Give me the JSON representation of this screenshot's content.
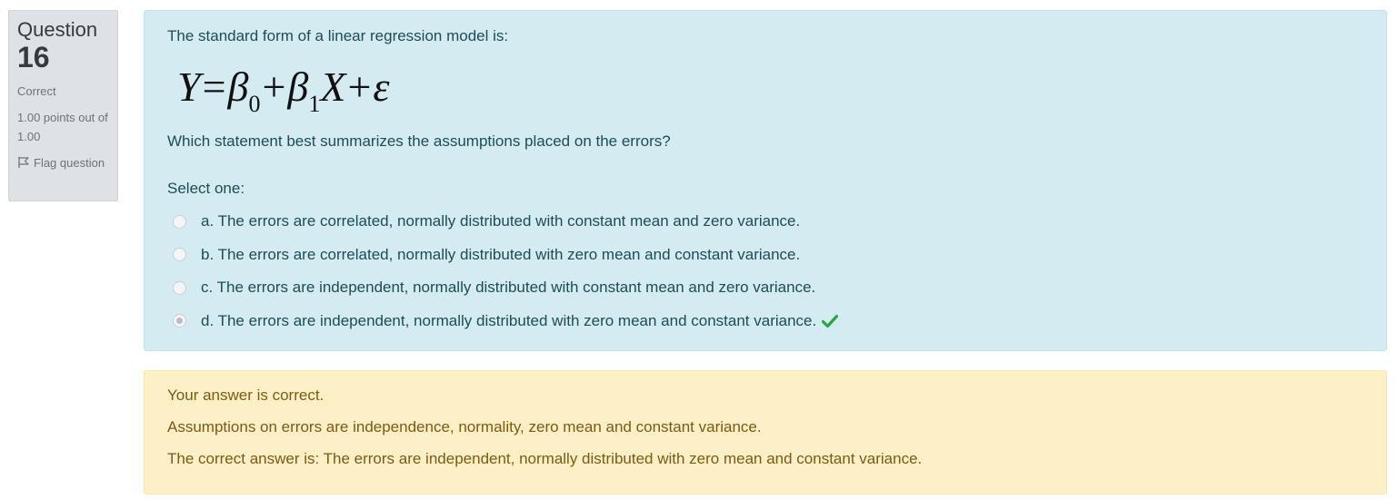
{
  "info": {
    "question_label": "Question",
    "question_number": "16",
    "state": "Correct",
    "grade": "1.00 points out of 1.00",
    "flag_label": "Flag question"
  },
  "question": {
    "intro": "The standard form of a linear regression model is:",
    "formula": {
      "y": "Y",
      "eq": "=",
      "beta": "β",
      "sub0": "0",
      "plus": "+",
      "sub1": "1",
      "x": "X",
      "epsilon": "ε"
    },
    "question_text": "Which statement best summarizes the assumptions placed on the errors?",
    "prompt": "Select one:",
    "answers": [
      {
        "text": "a. The errors are correlated, normally distributed with constant mean and zero variance.",
        "selected": false
      },
      {
        "text": "b. The errors are correlated, normally distributed with zero mean and constant variance.",
        "selected": false
      },
      {
        "text": "c. The errors are independent, normally distributed with constant mean and zero variance.",
        "selected": false
      },
      {
        "text": "d. The errors are independent, normally distributed with zero mean and constant variance.",
        "selected": true
      }
    ]
  },
  "feedback": {
    "result": "Your answer is correct.",
    "general": "Assumptions on errors are independence, normality, zero mean and constant variance.",
    "right_answer": "The correct answer is: The errors are independent, normally distributed with zero mean and constant variance."
  },
  "colors": {
    "content_bg": "#d4ecf1",
    "feedback_bg": "#fdefc6",
    "info_bg": "#dee2e6",
    "correct_check": "#28a745"
  },
  "icons": {
    "flag": "flag-icon",
    "correct": "check-icon"
  }
}
